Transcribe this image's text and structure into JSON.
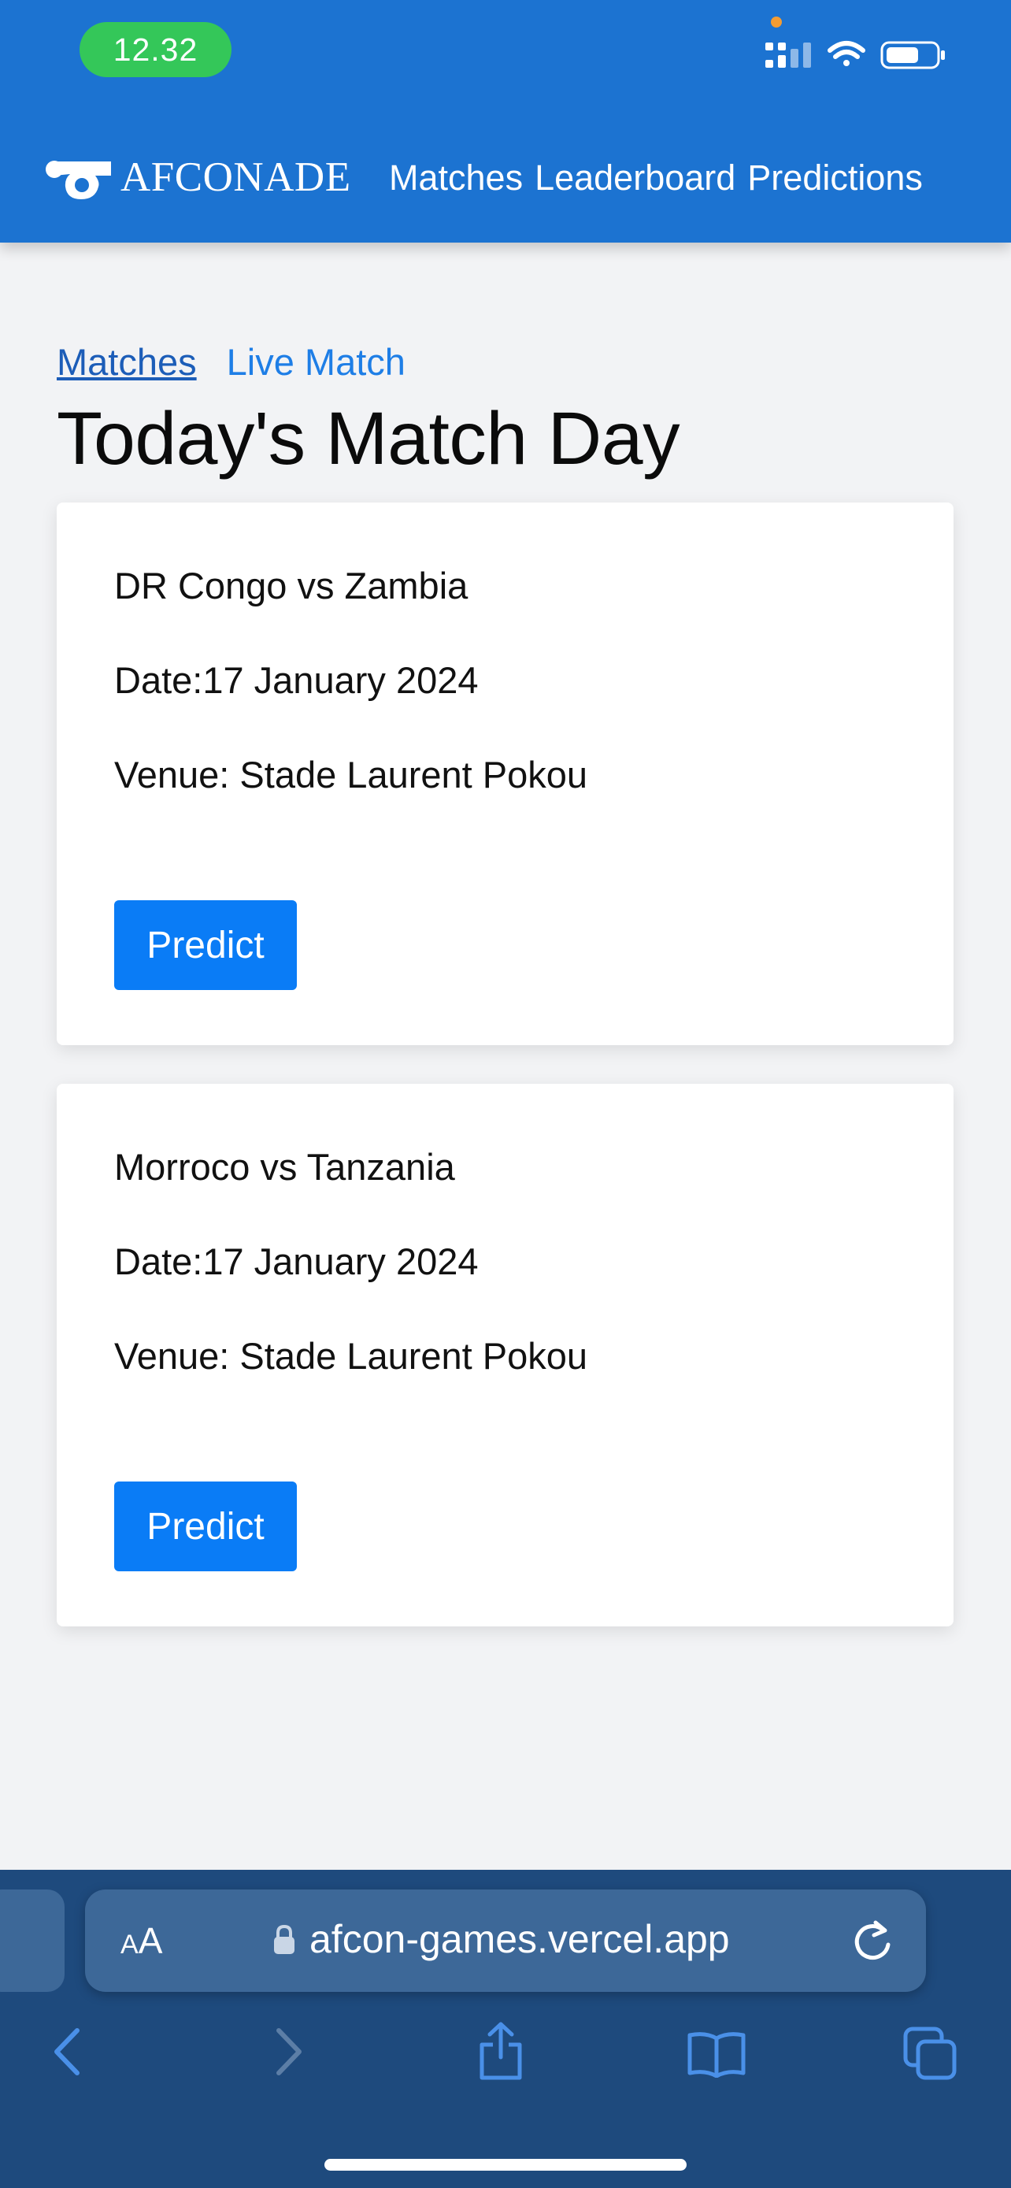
{
  "status_bar": {
    "time": "12.32"
  },
  "header": {
    "brand": "AFCONADE",
    "nav": [
      "Matches",
      "Leaderboard",
      "Predictions"
    ]
  },
  "breadcrumb": {
    "matches": "Matches",
    "live": "Live Match"
  },
  "page_title": "Today's Match Day",
  "matches": [
    {
      "teams": "DR Congo vs Zambia",
      "date": "Date:17 January 2024",
      "venue": "Venue: Stade Laurent Pokou",
      "button": "Predict"
    },
    {
      "teams": "Morroco vs Tanzania",
      "date": "Date:17 January 2024",
      "venue": "Venue: Stade Laurent Pokou",
      "button": "Predict"
    }
  ],
  "browser": {
    "text_size_label": "AA",
    "url": "afcon-games.vercel.app"
  },
  "colors": {
    "header_blue": "#1c73d1",
    "button_blue": "#0a7cf6",
    "time_pill_green": "#34c759",
    "safari_bar": "#1e4a7d"
  },
  "icons": [
    "signal-icon",
    "wifi-icon",
    "battery-icon",
    "whistle-logo-icon",
    "lock-icon",
    "reload-icon",
    "back-icon",
    "forward-icon",
    "share-icon",
    "bookmarks-icon",
    "tabs-icon"
  ]
}
